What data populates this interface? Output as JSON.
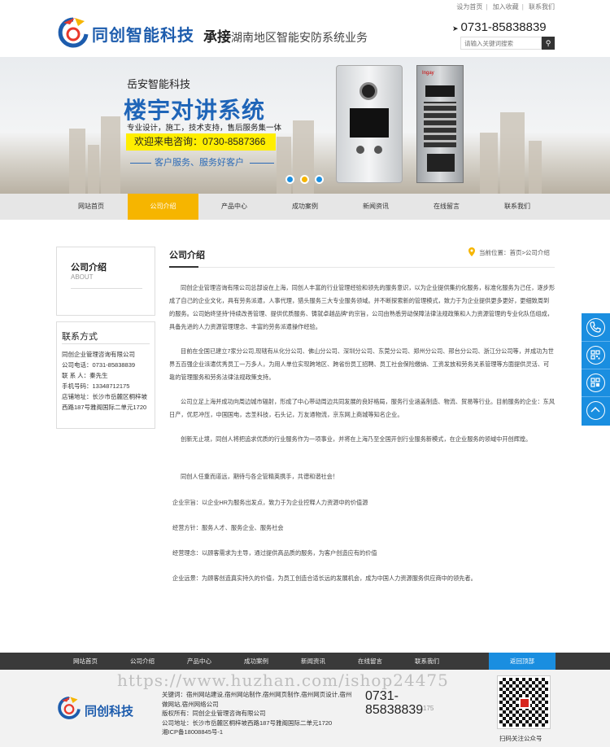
{
  "top_links": {
    "home": "设为首页",
    "fav": "加入收藏",
    "contact": "联系我们"
  },
  "header": {
    "logo_text": "同创智能科技",
    "slogan_bold": "承接",
    "slogan_rest": "湖南地区智能安防系统业务",
    "phone": "0731-85838839",
    "search_placeholder": "请输入关键词搜索"
  },
  "banner": {
    "company": "岳安智能科技",
    "title": "楼宇对讲系统",
    "subtitle": "专业设计，施工，技术支持，售后服务集一体",
    "hotline": "欢迎来电咨询：0730-8587366",
    "service": "客户服务、服务好客户",
    "device_brand": "Ingay",
    "active_slide": 2
  },
  "nav": {
    "items": [
      "网站首页",
      "公司介绍",
      "产品中心",
      "成功案例",
      "新闻资讯",
      "在线留言",
      "联系我们"
    ],
    "active_index": 1
  },
  "sidebar": {
    "about_title": "公司介绍",
    "about_en": "ABOUT",
    "contact_title": "联系方式",
    "contact_lines": [
      "同创企业管理咨询有限公司",
      "公司电话：0731-85838839",
      "联 系 人：秦先生",
      "手机号码：13348712175",
      "店铺地址：长沙市岳麓区桐梓坡",
      "西路187号雅阁国际二单元1720"
    ]
  },
  "content": {
    "title": "公司介绍",
    "breadcrumb": "当前位置：首页>公司介绍",
    "paragraphs": [
      "同创企业管理咨询有限公司总部设在上海，同创人丰富的行业管理经验和领先的服务意识，以为企业提供集约化服务，标准化服务为己任，逐步形成了自己的企业文化，具有劳务派遣，人事代理，猎头服务三大专业服务领域。并不断探索新的管理模式，致力于为企业提供更多更好，更细致周到的服务。公司始终坚持“持续改善管理、提供优质服务、铸就卓越品牌”的宗旨，公司由熟悉劳动保障法律法规政策和人力资源管理的专业化队伍组成，具备先进的人力资源管理理念、丰富的劳务派遣操作经验。",
      "目前在全国已建立7家分公司,现辖有从化分公司、佛山分公司、深圳分公司、东莞分公司、郑州分公司、邢台分公司、浙江分公司等，并成功为世界五百强企业派遣优秀员工一万多人，为用人单位实现跨地区、跨省份员工招聘、员工社会保险缴纳、工资发放和劳务关系管理等方面提供灵活、可靠的管理服务和劳务法律法规政策支持。",
      "公司立足上海并成功向周边城市辐射，形成了中心带动周边共同发展的良好格局，服务行业涵盖制造、物流、贸易等行业。目前服务的企业：东风日产，优尼冲压，中国国电，志圣科技，石头记，万友通物流，京东网上商城等知名企业。",
      "创新无止境，同创人将把追求优质的行业服务作为一项事业，并将在上海乃至全国开创行业服务新模式，在企业服务的领域中开创辉煌。",
      "同创人任重而道远，期待与各企管精英携手，共谱和谐社会！",
      "企业宗旨：以企业HR为服务出发点，致力于为企业控释人力资源中的价值源",
      "经营方针：服务人才、服务企业、服务社会",
      "经营理念：以顾客需求为主导，通过提供高品质的服务，为客户创造应有的价值",
      "企业远景：为顾客创造真实持久的价值，为员工创造合适长远的发展机会，成为中国人力资源服务供应商中的领先者。"
    ]
  },
  "footer_nav": {
    "items": [
      "网站首页",
      "公司介绍",
      "产品中心",
      "成功案例",
      "新闻资讯",
      "在线留言",
      "联系我们"
    ],
    "back_top": "返回顶部"
  },
  "footer": {
    "logo_text": "同创科技",
    "info_lines": [
      "关键词：宿州网站建设,宿州网站制作,宿州网页制作,宿州网页设计,宿州做网站,宿州网络公司",
      "版权所有：同创企业管理咨询有限公司",
      "公司地址：长沙市岳麓区桐梓坡西路187号雅阁国际二单元1720",
      "湘ICP备18008845号-1"
    ],
    "phone": "0731-85838839",
    "phone_tail": "175",
    "qr_label": "扫码关注公众号"
  },
  "watermark": "https://www.huzhan.com/ishop24475",
  "colors": {
    "accent": "#f6b500",
    "brand_blue": "#1d5cad",
    "float_blue": "#1a8ee0",
    "footer_dark": "#3a3a3a"
  }
}
